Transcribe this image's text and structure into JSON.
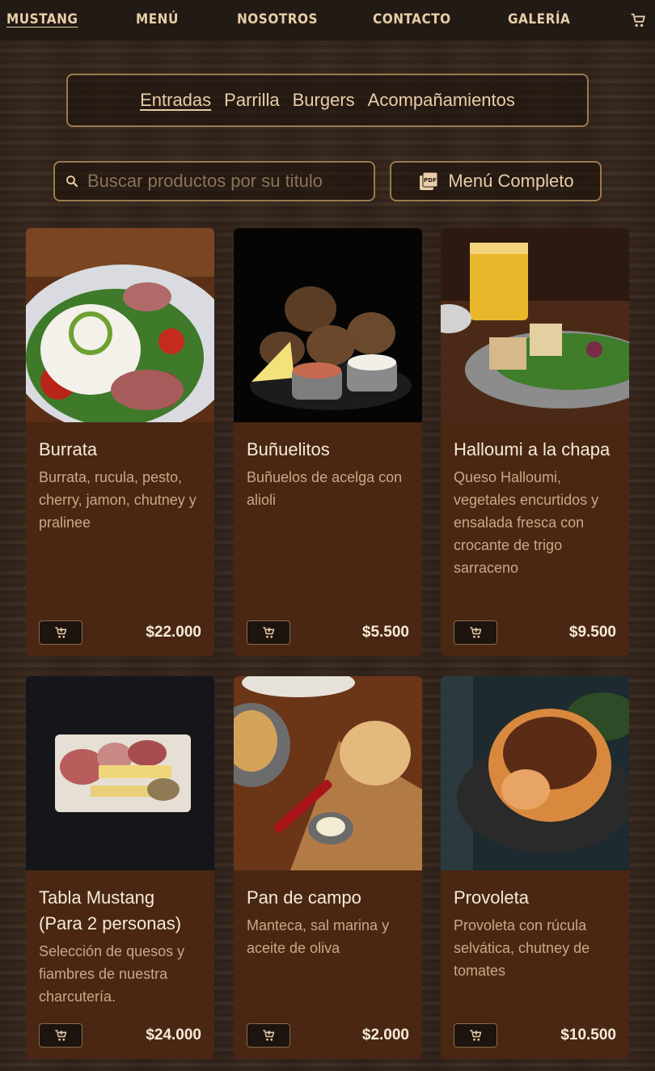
{
  "nav": {
    "brand": "MUSTANG",
    "items": [
      "MENÚ",
      "NOSOTROS",
      "CONTACTO",
      "GALERÍA"
    ]
  },
  "categories": [
    "Entradas",
    "Parrilla",
    "Burgers",
    "Acompañamientos"
  ],
  "search": {
    "placeholder": "Buscar productos por su titulo"
  },
  "menu_button": {
    "label": "Menú Completo"
  },
  "products": [
    {
      "title": "Burrata",
      "desc": "Burrata, rucula, pesto, cherry, jamon, chutney y pralinee",
      "price": "$22.000"
    },
    {
      "title": "Buñuelitos",
      "desc": "Buñuelos de acelga con alioli",
      "price": "$5.500"
    },
    {
      "title": "Halloumi a la chapa",
      "desc": "Queso Halloumi, vegetales encurtidos y ensalada fresca con crocante de trigo sarraceno",
      "price": "$9.500"
    },
    {
      "title": "Tabla Mustang (Para 2 personas)",
      "desc": "Selección de quesos y fiambres de nuestra charcutería.",
      "price": "$24.000"
    },
    {
      "title": "Pan de campo",
      "desc": "Manteca, sal marina y aceite de oliva",
      "price": "$2.000"
    },
    {
      "title": "Provoleta",
      "desc": "Provoleta con rúcula selvática, chutney de tomates",
      "price": "$10.500"
    }
  ],
  "colors": {
    "nav_bg": "#221a14",
    "accent": "#e8cda7",
    "border": "#9a7a4d",
    "card_bg": "#4a2712"
  },
  "icons": [
    "cart-icon",
    "search-icon",
    "pdf-icon",
    "add-to-cart-icon"
  ]
}
